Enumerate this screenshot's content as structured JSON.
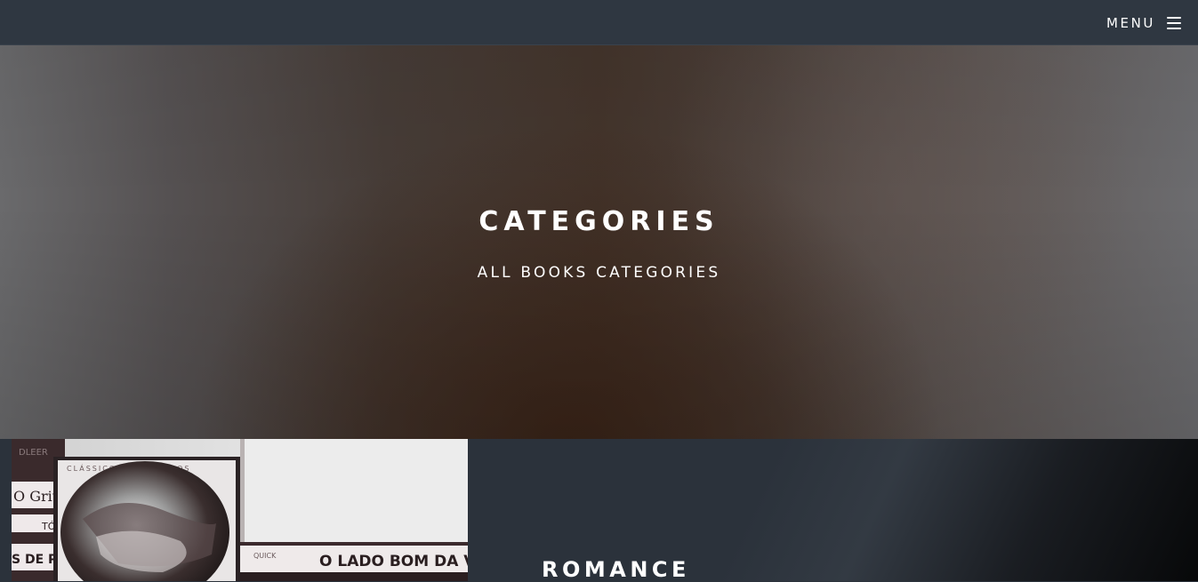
{
  "nav": {
    "menu_label": "MENU"
  },
  "hero": {
    "title": "CATEGORIES",
    "subtitle": "ALL BOOKS CATEGORIES"
  },
  "category": {
    "title": "ROMANCE",
    "image": {
      "series_label": "CLÁSSICOS PARA TODOS",
      "spine_text_1": "O LADO BOM DA V",
      "spine_text_2": "O Grit",
      "spine_text_3": "TÓ",
      "spine_text_4": "S DE PI",
      "spine_text_5": "QUICK",
      "spine_text_6": "DLEER"
    }
  },
  "colors": {
    "navbar": "#2f3741",
    "section_bg": "#2b323b",
    "text": "#ffffff"
  },
  "icons": {
    "menu": "hamburger-icon"
  }
}
